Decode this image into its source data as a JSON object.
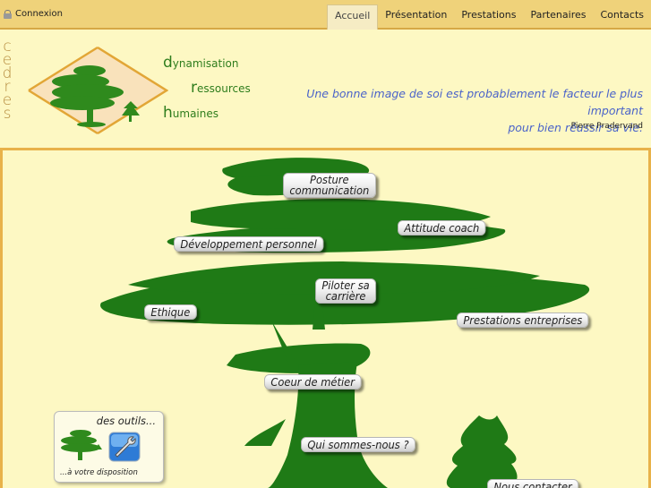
{
  "topbar": {
    "login_label": "Connexion",
    "nav": [
      {
        "label": "Accueil",
        "active": true
      },
      {
        "label": "Présentation",
        "active": false
      },
      {
        "label": "Prestations",
        "active": false
      },
      {
        "label": "Partenaires",
        "active": false
      },
      {
        "label": "Contacts",
        "active": false
      }
    ]
  },
  "header": {
    "brand_vertical": [
      "c",
      "e",
      "d",
      "r",
      "e",
      "s"
    ],
    "drh": [
      {
        "cap": "d",
        "rest": "ynamisation"
      },
      {
        "cap": "r",
        "rest": "essources"
      },
      {
        "cap": "h",
        "rest": "umaines"
      }
    ],
    "quote_line1": "Une bonne image de soi est probablement le facteur le plus important",
    "quote_line2": "pour bien réussir sa vie.",
    "author": "Pierre Pradervand"
  },
  "tree_links": {
    "posture": "Posture\ncommunication",
    "attitude": "Attitude coach",
    "developpement": "Développement personnel",
    "piloter": "Piloter sa\ncarrière",
    "ethique": "Ethique",
    "prestations": "Prestations entreprises",
    "coeur": "Coeur de métier",
    "qui": "Qui sommes-nous ?",
    "contacter": "Nous contacter"
  },
  "tools_box": {
    "title": "des outils...",
    "subtitle": "...à votre disposition"
  },
  "colors": {
    "tree_green": "#1f7a16",
    "topbar": "#efd27a",
    "header_bg": "#fdf8c3",
    "quote": "#4a63c9",
    "border": "#e8b24a"
  },
  "icons": [
    "lock-icon",
    "wrench-icon",
    "cedar-logo"
  ]
}
